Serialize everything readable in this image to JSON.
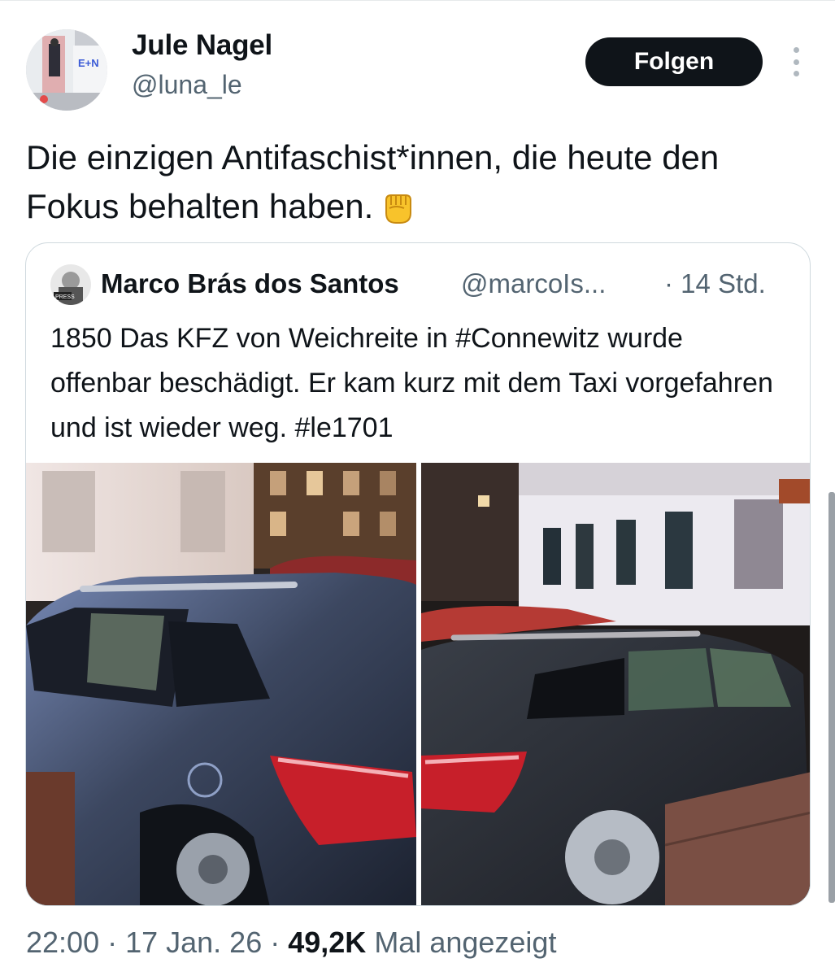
{
  "author": {
    "name": "Jule Nagel",
    "handle": "@luna_le",
    "avatar_sign_text": "E+N"
  },
  "follow_button": {
    "label": "Folgen"
  },
  "tweet": {
    "text": "Die einzigen Antifaschist*innen, die heute den Fokus behalten haben.",
    "emoji": "raised-fist"
  },
  "quote": {
    "name": "Marco Brás dos Santos",
    "handle": "@marcoIs...",
    "time": "· 14 Std.",
    "text": "1850 Das KFZ von Weichreite in #Connewitz wurde offenbar beschädigt. Er kam kurz mit dem Taxi vorgefahren und ist wieder weg. #le1701",
    "avatar_label": "PRESS"
  },
  "footer": {
    "time": "22:00",
    "sep1": " · ",
    "date": "17 Jan. 26",
    "sep2": " · ",
    "views": "49,2K",
    "views_label": " Mal angezeigt"
  },
  "colors": {
    "text": "#0f1419",
    "secondary": "#536471",
    "border": "#cfd9de",
    "button_bg": "#0f1419"
  }
}
